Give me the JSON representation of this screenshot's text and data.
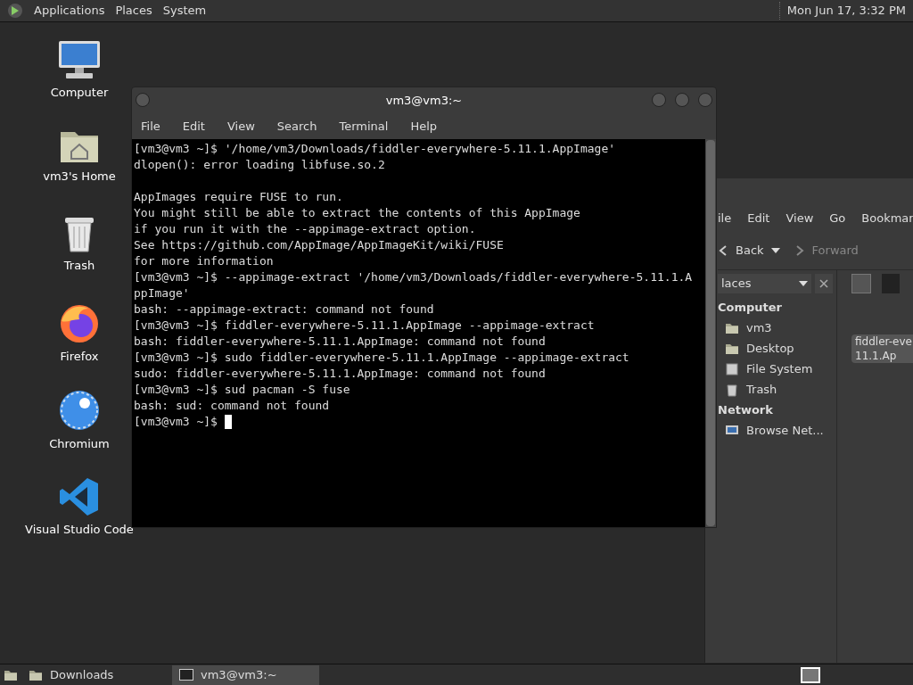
{
  "top_panel": {
    "menus": [
      "Applications",
      "Places",
      "System"
    ],
    "clock": "Mon Jun 17,  3:32 PM"
  },
  "desktop_icons": [
    {
      "kind": "computer",
      "label": "Computer"
    },
    {
      "kind": "home",
      "label": "vm3's Home"
    },
    {
      "kind": "trash",
      "label": "Trash"
    },
    {
      "kind": "firefox",
      "label": "Firefox"
    },
    {
      "kind": "chromium",
      "label": "Chromium"
    },
    {
      "kind": "vscode",
      "label": "Visual Studio Code"
    }
  ],
  "terminal": {
    "title": "vm3@vm3:~",
    "menus": [
      "File",
      "Edit",
      "View",
      "Search",
      "Terminal",
      "Help"
    ],
    "cursor": true,
    "lines": [
      {
        "kind": "text",
        "text": "[vm3@vm3 ~]$ '/home/vm3/Downloads/fiddler-everywhere-5.11.1.AppImage'"
      },
      {
        "kind": "text",
        "text": "dlopen(): error loading libfuse.so.2"
      },
      {
        "kind": "gap"
      },
      {
        "kind": "text",
        "text": "AppImages require FUSE to run."
      },
      {
        "kind": "text",
        "text": "You might still be able to extract the contents of this AppImage"
      },
      {
        "kind": "text",
        "text": "if you run it with the --appimage-extract option."
      },
      {
        "kind": "text",
        "text": "See https://github.com/AppImage/AppImageKit/wiki/FUSE"
      },
      {
        "kind": "text",
        "text": "for more information"
      },
      {
        "kind": "text",
        "text": "[vm3@vm3 ~]$ --appimage-extract '/home/vm3/Downloads/fiddler-everywhere-5.11.1.A"
      },
      {
        "kind": "text",
        "text": "ppImage'"
      },
      {
        "kind": "text",
        "text": "bash: --appimage-extract: command not found"
      },
      {
        "kind": "text",
        "text": "[vm3@vm3 ~]$ fiddler-everywhere-5.11.1.AppImage --appimage-extract"
      },
      {
        "kind": "text",
        "text": "bash: fiddler-everywhere-5.11.1.AppImage: command not found"
      },
      {
        "kind": "text",
        "text": "[vm3@vm3 ~]$ sudo fiddler-everywhere-5.11.1.AppImage --appimage-extract"
      },
      {
        "kind": "text",
        "text": "sudo: fiddler-everywhere-5.11.1.AppImage: command not found"
      },
      {
        "kind": "text",
        "text": "[vm3@vm3 ~]$ sud pacman -S fuse"
      },
      {
        "kind": "text",
        "text": "bash: sud: command not found"
      },
      {
        "kind": "text",
        "text": "[vm3@vm3 ~]$ "
      }
    ]
  },
  "file_manager": {
    "menus": [
      "ile",
      "Edit",
      "View",
      "Go",
      "Bookmar"
    ],
    "back": "Back",
    "forward": "Forward",
    "sidebar_selector": "laces",
    "sidebar": [
      {
        "kind": "heading",
        "label": "Computer"
      },
      {
        "kind": "home",
        "label": "vm3"
      },
      {
        "kind": "folder",
        "label": "Desktop"
      },
      {
        "kind": "drive",
        "label": "File System"
      },
      {
        "kind": "trash",
        "label": "Trash"
      },
      {
        "kind": "heading",
        "label": "Network"
      },
      {
        "kind": "network",
        "label": "Browse Net..."
      }
    ],
    "file_label": [
      "fiddler-eve",
      "11.1.Ap"
    ]
  },
  "taskbar": [
    {
      "kind": "folder",
      "label": "Downloads",
      "selected": false
    },
    {
      "kind": "terminal",
      "label": "vm3@vm3:~",
      "selected": true
    }
  ]
}
